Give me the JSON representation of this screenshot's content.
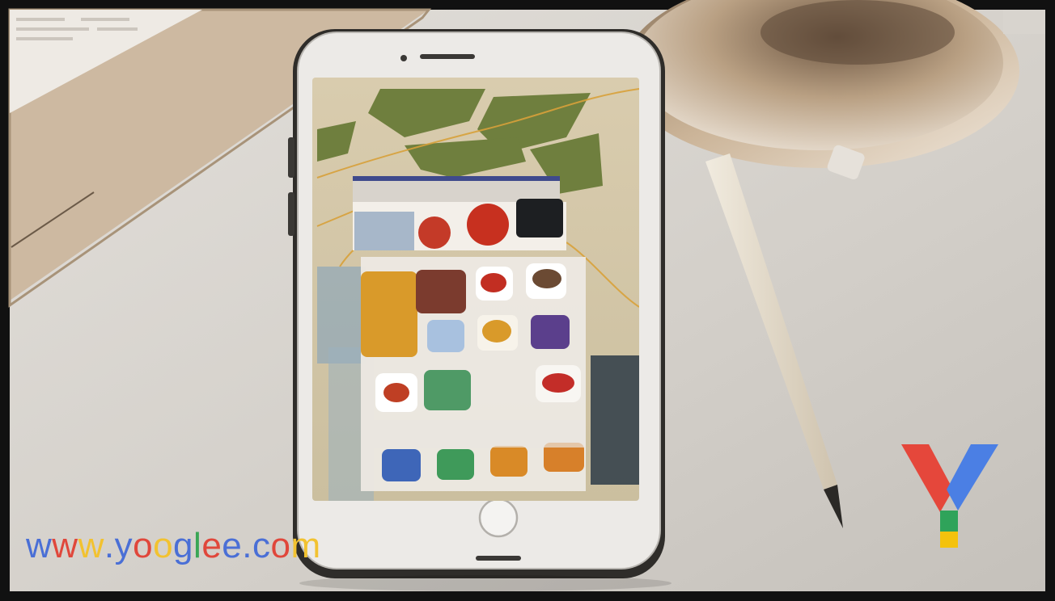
{
  "scene": {
    "description_objects": [
      "notebook",
      "smartphone",
      "desk-lamp",
      "pencil"
    ],
    "colors": {
      "frame": "#111111",
      "desk": "#d6d2cc",
      "notebook": "#cdb9a1",
      "phone_body": "#e9e8e6",
      "phone_bezel": "#3a3835",
      "lamp_inner": "#b9a083",
      "pencil": "#e6dccb"
    }
  },
  "watermark": {
    "text_chars": [
      "w",
      "w",
      "w",
      ".",
      "y",
      "o",
      "o",
      "g",
      "l",
      "e",
      "e",
      ".",
      "c",
      "o",
      "m"
    ],
    "char_colors": [
      "#4a6fd6",
      "#e0473b",
      "#f2c230",
      "#4a6fd6",
      "#4a6fd6",
      "#e0473b",
      "#f2c230",
      "#4a6fd6",
      "#3aa655",
      "#e0473b",
      "#4a6fd6",
      "#4a6fd6",
      "#4a6fd6",
      "#e0473b",
      "#f2c230"
    ],
    "logo_colors": {
      "red": "#e5473b",
      "blue": "#4b7fe4",
      "green": "#2fa35a",
      "yellow": "#f4c20d"
    }
  }
}
